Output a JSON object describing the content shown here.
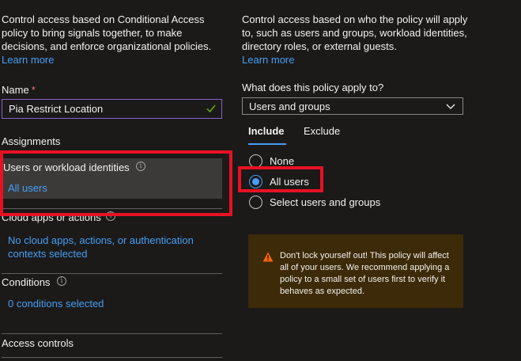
{
  "left": {
    "description": "Control access based on Conditional Access policy to bring signals together, to make decisions, and enforce organizational policies.",
    "learn_more": "Learn more",
    "name_label": "Name",
    "required_mark": "*",
    "name_value": "Pia Restrict Location",
    "assignments_label": "Assignments",
    "users_title": "Users or workload identities",
    "users_value": "All users",
    "cloud_title": "Cloud apps or actions",
    "cloud_value": "No cloud apps, actions, or authentication contexts selected",
    "conditions_title": "Conditions",
    "conditions_value": "0 conditions selected",
    "access_controls_label": "Access controls",
    "info_glyph": "i"
  },
  "right": {
    "description": "Control access based on who the policy will apply to, such as users and groups, workload identities, directory roles, or external guests.",
    "learn_more": "Learn more",
    "applies_label": "What does this policy apply to?",
    "applies_value": "Users and groups",
    "tabs": {
      "include": "Include",
      "exclude": "Exclude"
    },
    "radios": [
      {
        "label": "None",
        "selected": false
      },
      {
        "label": "All users",
        "selected": true
      },
      {
        "label": "Select users and groups",
        "selected": false
      }
    ],
    "warning": "Don't lock yourself out! This policy will affect all of your users. We recommend applying a policy to a small set of users first to verify it behaves as expected."
  },
  "colors": {
    "background": "#1b1a19",
    "accent": "#479ef5",
    "highlight": "#e81123",
    "warning_bg": "#3c2a08",
    "warning_icon": "#f7630c"
  },
  "icons": [
    "checkmark-icon",
    "info-icon",
    "chevron-down-icon",
    "warning-icon"
  ]
}
